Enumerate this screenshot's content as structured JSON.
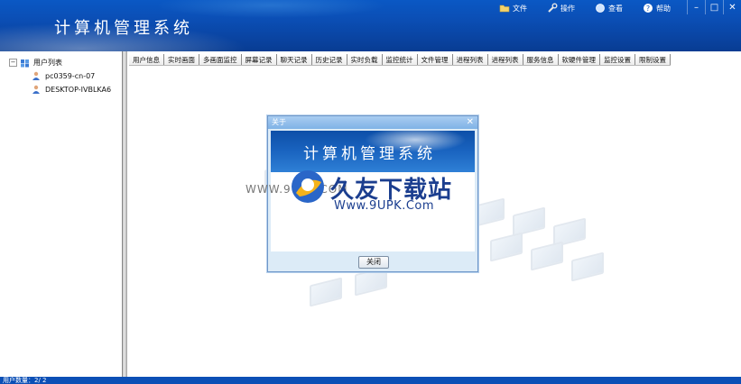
{
  "app": {
    "title": "计算机管理系统"
  },
  "top_menu": [
    {
      "label": "文件",
      "icon": "folder-icon"
    },
    {
      "label": "操作",
      "icon": "wrench-icon"
    },
    {
      "label": "查看",
      "icon": "view-icon"
    },
    {
      "label": "帮助",
      "icon": "help-icon"
    }
  ],
  "window_controls": {
    "minimize": "–",
    "maximize": "□",
    "close": "✕"
  },
  "tree": {
    "expand_symbol": "−",
    "root_label": "用户列表",
    "nodes": [
      "pc0359-cn-07",
      "DESKTOP-IVBLKA6"
    ]
  },
  "tabs": [
    "用户信息",
    "实时画面",
    "多画面监控",
    "屏幕记录",
    "聊天记录",
    "历史记录",
    "实时负载",
    "监控统计",
    "文件管理",
    "进程列表",
    "进程列表",
    "服务信息",
    "软硬件管理",
    "监控设置",
    "限制设置"
  ],
  "dialog": {
    "title": "关于",
    "close_symbol": "✕",
    "banner_title": "计算机管理系统",
    "button_label": "关闭"
  },
  "watermark": {
    "left_text": "WWW.9UPK.COM",
    "brand": "久友下载站",
    "url": "Www.9UPK.Com"
  },
  "status": {
    "text": "用户数量：2/ 2"
  },
  "colors": {
    "title_bar": "#0b4fb6",
    "dialog_bg": "#dcebf7",
    "brand_blue": "#1b3e8f"
  }
}
